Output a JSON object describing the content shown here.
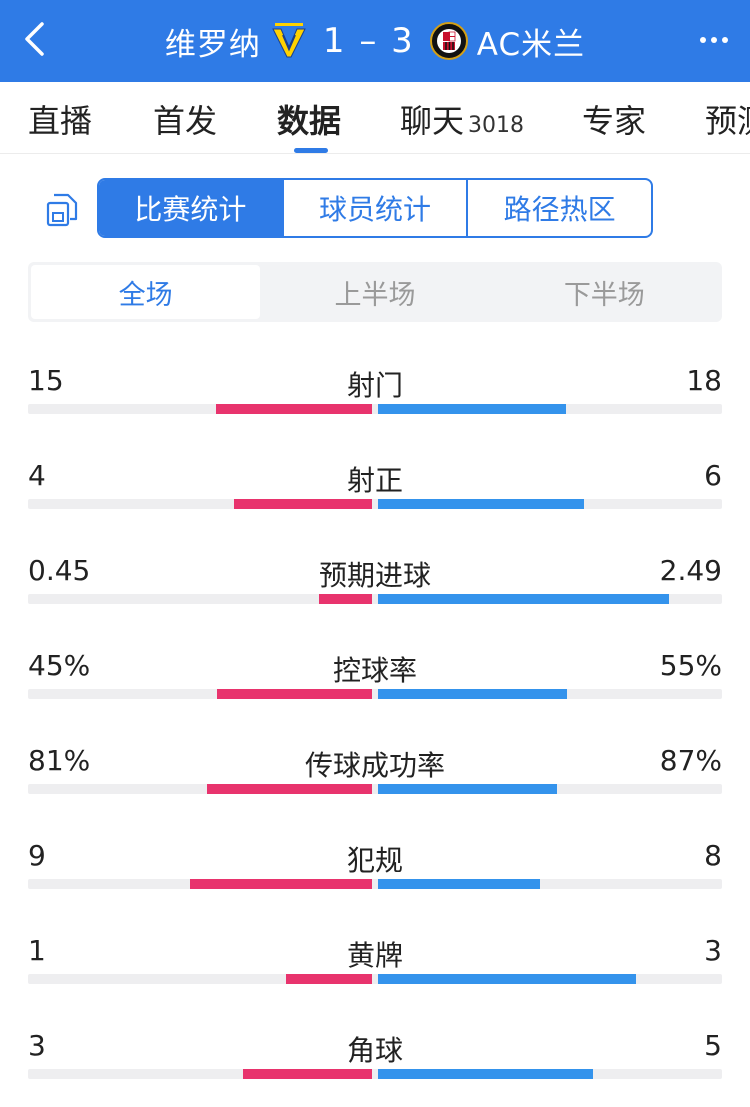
{
  "header": {
    "home_team": "维罗纳",
    "home_crest": "hellas-verona-crest",
    "score": "1 – 3",
    "away_team": "AC米兰",
    "away_crest": "ac-milan-crest",
    "colors": {
      "header_bg": "#2f7be6",
      "home_bar": "#e8336d",
      "away_bar": "#3493ec"
    }
  },
  "tabs": [
    {
      "label": "直播"
    },
    {
      "label": "首发"
    },
    {
      "label": "数据",
      "active": true
    },
    {
      "label": "聊天",
      "sub": "3018"
    },
    {
      "label": "专家"
    },
    {
      "label": "预测"
    }
  ],
  "segment": {
    "items": [
      "比赛统计",
      "球员统计",
      "路径热区"
    ],
    "active": "比赛统计"
  },
  "period": {
    "items": [
      "全场",
      "上半场",
      "下半场"
    ],
    "active": "全场"
  },
  "stats": [
    {
      "label": "射门",
      "home": "15",
      "away": "18",
      "home_share": 0.4545,
      "away_share": 0.5455
    },
    {
      "label": "射正",
      "home": "4",
      "away": "6",
      "home_share": 0.4,
      "away_share": 0.6
    },
    {
      "label": "预期进球",
      "home": "0.45",
      "away": "2.49",
      "home_share": 0.153,
      "away_share": 0.847
    },
    {
      "label": "控球率",
      "home": "45%",
      "away": "55%",
      "home_share": 0.45,
      "away_share": 0.55
    },
    {
      "label": "传球成功率",
      "home": "81%",
      "away": "87%",
      "home_share": 0.48,
      "away_share": 0.52
    },
    {
      "label": "犯规",
      "home": "9",
      "away": "8",
      "home_share": 0.53,
      "away_share": 0.47
    },
    {
      "label": "黄牌",
      "home": "1",
      "away": "3",
      "home_share": 0.25,
      "away_share": 0.75
    },
    {
      "label": "角球",
      "home": "3",
      "away": "5",
      "home_share": 0.375,
      "away_share": 0.625
    }
  ]
}
